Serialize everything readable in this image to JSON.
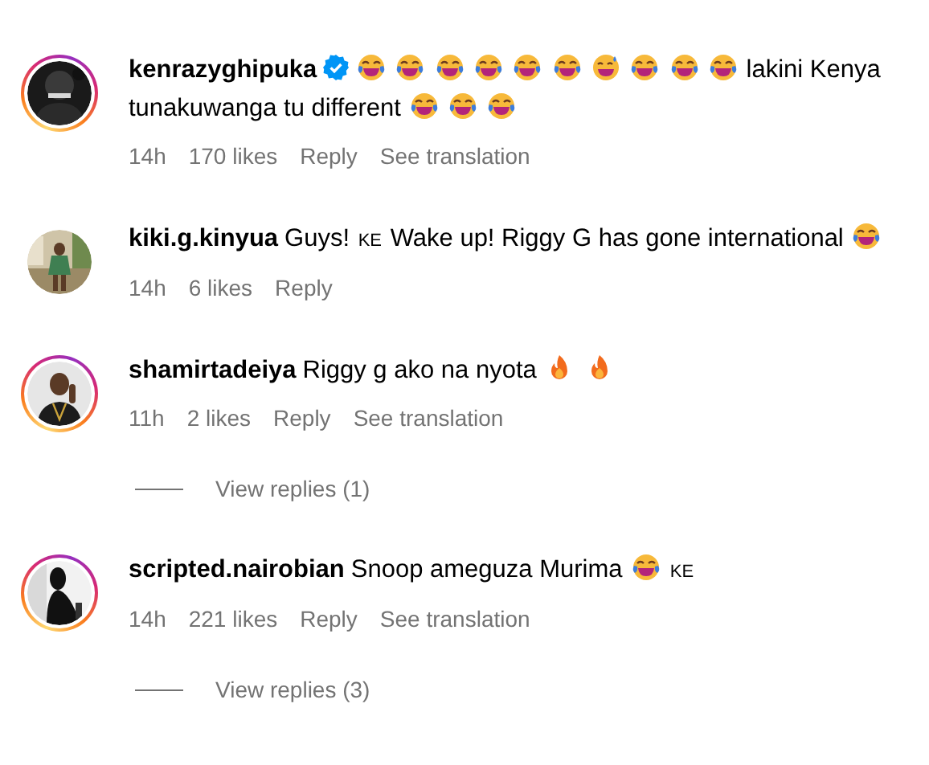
{
  "comments": [
    {
      "username": "kenrazyghipuka",
      "verified": true,
      "story_ring": true,
      "avatar": {
        "kind": "picture"
      },
      "body": [
        {
          "kind": "laugh"
        },
        {
          "kind": "laugh"
        },
        {
          "kind": "laugh"
        },
        {
          "kind": "laugh"
        },
        {
          "kind": "laugh"
        },
        {
          "kind": "laugh"
        },
        {
          "kind": "sweat"
        },
        {
          "kind": "laugh"
        },
        {
          "kind": "laugh"
        },
        {
          "kind": "laugh"
        },
        {
          "kind": "text",
          "text": "lakini Kenya"
        },
        {
          "kind": "text",
          "text": "tunakuwanga tu different"
        },
        {
          "kind": "laugh"
        },
        {
          "kind": "laugh"
        },
        {
          "kind": "laugh"
        }
      ],
      "time": "14h",
      "likes": "170 likes",
      "reply": "Reply",
      "translate": "See translation"
    },
    {
      "username": "kiki.g.kinyua",
      "verified": false,
      "story_ring": false,
      "avatar": {
        "kind": "picture"
      },
      "body": [
        {
          "kind": "text",
          "text": "Guys!"
        },
        {
          "kind": "flag",
          "text": "KE"
        },
        {
          "kind": "text",
          "text": "Wake up! Riggy G has gone international"
        },
        {
          "kind": "laugh"
        }
      ],
      "time": "14h",
      "likes": "6 likes",
      "reply": "Reply"
    },
    {
      "username": "shamirtadeiya",
      "verified": false,
      "story_ring": true,
      "avatar": {
        "kind": "picture"
      },
      "body": [
        {
          "kind": "text",
          "text": "Riggy g ako na nyota"
        },
        {
          "kind": "fire"
        },
        {
          "kind": "fire"
        }
      ],
      "time": "11h",
      "likes": "2 likes",
      "reply": "Reply",
      "translate": "See translation",
      "view_replies": "View replies (1)"
    },
    {
      "username": "scripted.nairobian",
      "verified": false,
      "story_ring": true,
      "avatar": {
        "kind": "picture"
      },
      "body": [
        {
          "kind": "text",
          "text": "Snoop ameguza Murima"
        },
        {
          "kind": "laugh"
        },
        {
          "kind": "flag",
          "text": "KE"
        }
      ],
      "time": "14h",
      "likes": "221 likes",
      "reply": "Reply",
      "translate": "See translation",
      "view_replies": "View replies (3)"
    }
  ]
}
